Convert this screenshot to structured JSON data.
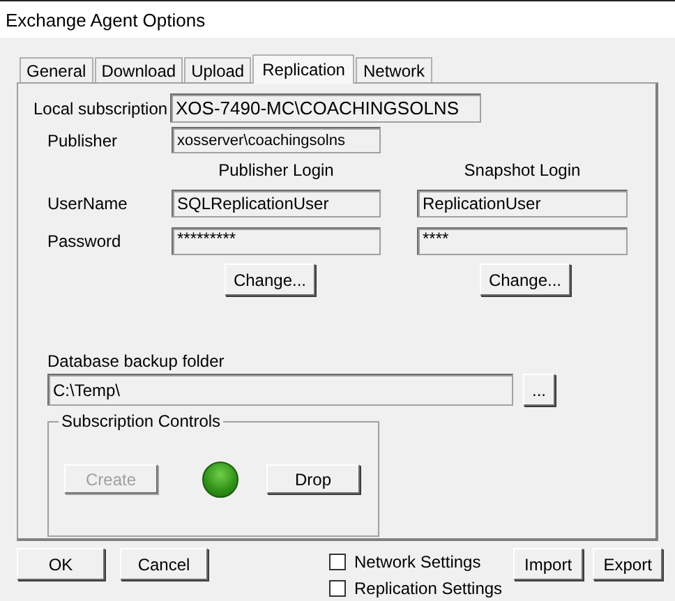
{
  "window": {
    "title": "Exchange Agent Options"
  },
  "tabs": [
    {
      "label": "General",
      "selected": false
    },
    {
      "label": "Download",
      "selected": false
    },
    {
      "label": "Upload",
      "selected": false
    },
    {
      "label": "Replication",
      "selected": true
    },
    {
      "label": "Network",
      "selected": false
    }
  ],
  "local_subscription": {
    "label": "Local subscription",
    "value": "XOS-7490-MC\\COACHINGSOLNS"
  },
  "publisher": {
    "label": "Publisher",
    "value": "xosserver\\coachingsolns"
  },
  "logins": {
    "columns": [
      "Publisher Login",
      "Snapshot Login"
    ],
    "rows": [
      {
        "label": "UserName",
        "values": [
          "SQLReplicationUser",
          "ReplicationUser"
        ]
      },
      {
        "label": "Password",
        "values": [
          "*********",
          "****"
        ]
      }
    ],
    "buttons": [
      "Change...",
      "Change..."
    ]
  },
  "backup_folder": {
    "label": "Database backup folder",
    "value": "C:\\Temp\\",
    "browse_button": "..."
  },
  "subscription_controls": {
    "title": "Subscription Controls",
    "create": {
      "label": "Create",
      "disabled": true
    },
    "status": {
      "active": true
    },
    "drop": {
      "label": "Drop",
      "disabled": false
    }
  },
  "footer": {
    "buttons": [
      "OK",
      "Cancel"
    ],
    "checkboxes": [
      {
        "label": "Network Settings",
        "checked": false
      },
      {
        "label": "Replication Settings",
        "checked": false
      }
    ],
    "right_buttons": [
      "Import",
      "Export"
    ]
  }
}
